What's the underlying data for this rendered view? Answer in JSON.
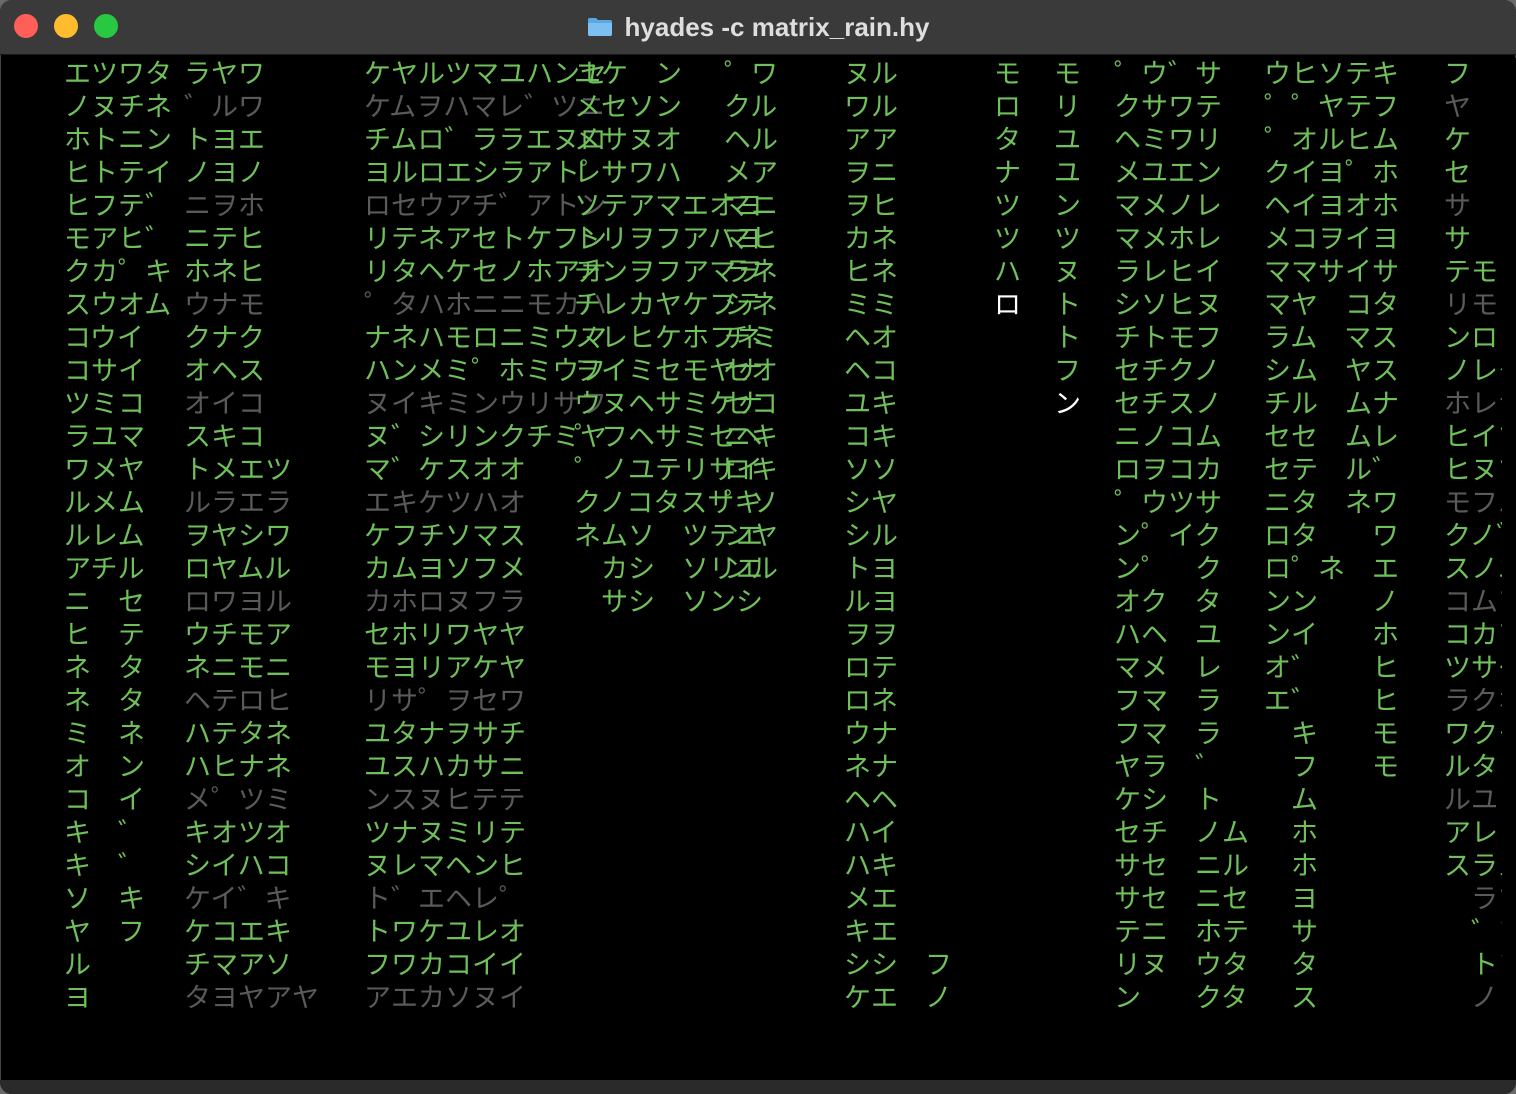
{
  "window": {
    "title": "hyades -c matrix_rain.hy",
    "title_icon": "folder-icon",
    "traffic_lights": [
      "close",
      "minimize",
      "zoom"
    ]
  },
  "colors": {
    "green": "#6fbf5a",
    "dim": "#5a5a5a",
    "head": "#ffffff",
    "background": "#000000"
  },
  "rain": {
    "columns": [
      "エツワタ\nノヌチネ\nホトニン\nヒトテイ\nヒフテ゛\nモアヒ゛\nクカ゜キ\nスウオム\nコウイ\nコサイ\nツミコ\nラユマ\nワメヤ\nルメム\nルレム\nアチル\nニ　セ\nヒ　テ\nネ　タ\nネ　タ\nミ　ネ\nオ　ン\nコ　イ\nキ　゛\nキ　゛\nソ　キ\nヤ　フ\nル\nヨ",
      "ラヤワ\n゛ルワ\nトヨエ\nノヨノ\nニヲホ\nニテヒ\nホネヒ\nウナモ\nクナク\nオヘス\nオイコ\nスキコ\nトメエツ\nルラエラ\nヲヤシワ\nロヤムル\nロワヨル\nウチモア\nネニモニ\nヘテロヒ\nハテタネ\nハヒナネ\nメ゜ツミ\nキオツオ\nシイハコ\nケイ゛キ\nケコエキ\nチマアソ\nタヨヤアヤ",
      "ケヤルツマユハンセ\nケムヲハマレ゛ツニ\nチムロ゛ララエヌロ\nヨルロエシラアト゜\nロセウアチ゛アトン\nリテネアセトケフン\nリタヘケセノホアオ\n゜タハホニニモカハ\nナネハモロニミウマ\nハンメミ゜ホミウフ\nヌイキミンウリサフ\nヌ゛シリンクチミヤ\nマ゛ケスオオ\nエキケツハオ\nケフチソマス\nカムヨソフメ\nカホロヌフラ\nセホリワヤヤ\nモヨリアケヤ\nリサ゜ヲセワ\nユタナヲサチ\nユスハカサニ\nンスヌヒテテ\nツナヌミリテ\nヌレマヘンヒ\nト゛エヘレ゜\nトワケユレオ\nフワカコイイ\nアエカソヌイ",
      "ユケ　ン\nメセソン\nメサヌオ\nレサワハ\nソテアマエオヨ\nトリヲフアハヨ\nチンヲフアマヲ\nチレカヤケフテ\nノレヒケホフネ\nヲイミセモヤナ\nウヌヘサミケナ\n゜フヘサミセヘ\n゜ノユテリサイ\nクノコタスサキ\nネムソ　ツテエ\n　カシ　ソリエ\n　サシ　ソンシ",
      "゜ワ\nクル\nヘル\nメア\nマニ\nマヒ\nラネ\nシネ\nチミ\nセオ\nセコ\nニキ\nロキ\n゜ソ\nンヤ\nンル",
      "ヌル\nワル\nアア\nヲニ\nヲヒ\nカネ\nヒネ\nミミ\nヘオ\nヘコ\nユキ\nコキ\nソソ\nシヤ\nシル\nトヨ\nルヨ\nヲヲ\nロテ\nロネ\nウナ\nネナ\nヘヘ\nハイ\nハキ\nメエ\nキエ\nシシ　フ\nケエ　ノ",
      "モ\nロ\nタ\nナ\nツ\nツ\nハ\nロ",
      "モ\nリ\nユ\nユ\nン\nツ\nヌ\nト\nト\nフ\nン",
      "゜ウ゛サ\nクサワテ\nヘミワリ\nメユエン\nマメノレ\nマメホレ\nラレヒイ\nシソヒヌ\nチトモフ\nセチクノ\nセチスノ\nニノコム\nロヲコカ\n゜ウツサ\nン゜イク\nン゜　ク\nオク　タ\nハヘ　ユ\nマメ　レ\nフマ　ラ\nフマ　ラ\nヤラ　゛\nケシ　ト\nセチ　ノム\nサセ　ニル\nサセ　ニセ\nテニ　ホテ\nリヌ　ウタ\nン　　クタ",
      "ウヒソテキ\n゜゜ヤテフ\n゜オルヒム\nクイヨ゜ホ\nヘイヨオホ\nメコヲイヨ\nママサイサ\nマヤ　コタ\nラム　マス\nシム　ヤス\nチル　ムナ\nセセ　ムレ\nセテ　ル゛\nニタ　ネワ\nロタ　　ワ\nロ゜ネ　エ\nンン　　ノ\nンイ　　ホ\nオ゛　　ヒ\nエ゛　　ヒ\n　キ　　モ\n　フ　　モ\n　ム　　　\n　ホ　　　\n　ホ　　　\n　ヨ　　　\n　サ　　　\n　タ　　　\n　ス",
      "フ\nヤ\nケ\nセ\nサ\nサ\nテモ\nリモ\nンロ\nノレタ\nホレナ\nヒイツ\nヒヌツ\nモフハ\nクノ゛\nスノエ\nコムア\nコカア\nツサケ\nラクホ\nワクモ\nルタミ\nルユミ\nアレリ\nスラス\n　ラツ\n　゛ソ\n　トソ\n　ノヌ"
    ]
  }
}
